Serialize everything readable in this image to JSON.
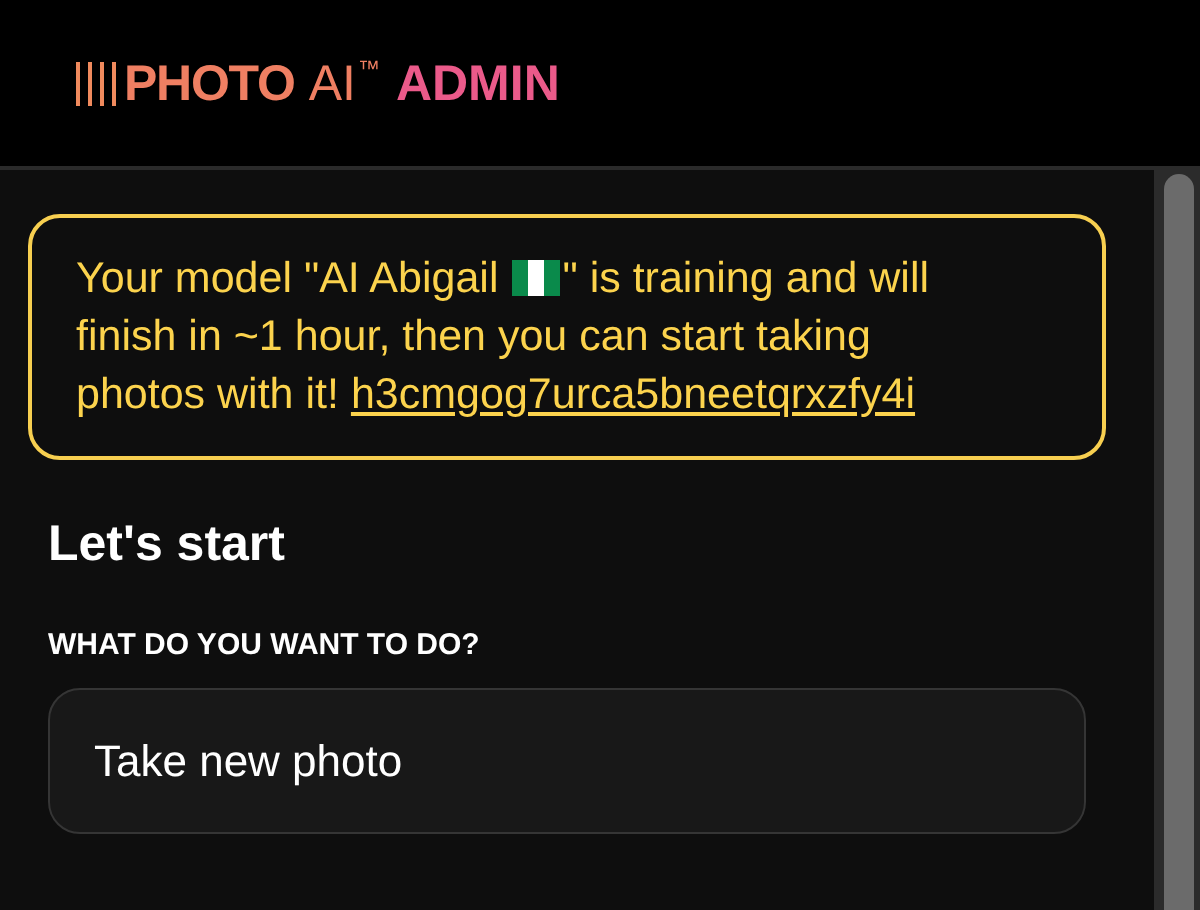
{
  "header": {
    "logo": "PHOTO",
    "logo_suffix": "AI",
    "logo_mark": "™",
    "section": "ADMIN"
  },
  "notice": {
    "text_before_flag": "Your model \"AI Abigail",
    "text_after_flag": "\" is training and will finish in ~1 hour, then you can start taking photos with it!",
    "link": "h3cmgog7urca5bneetqrxzfy4i"
  },
  "heading": "Let's start",
  "field": {
    "label": "WHAT DO YOU WANT TO DO?",
    "value": "Take new photo"
  }
}
